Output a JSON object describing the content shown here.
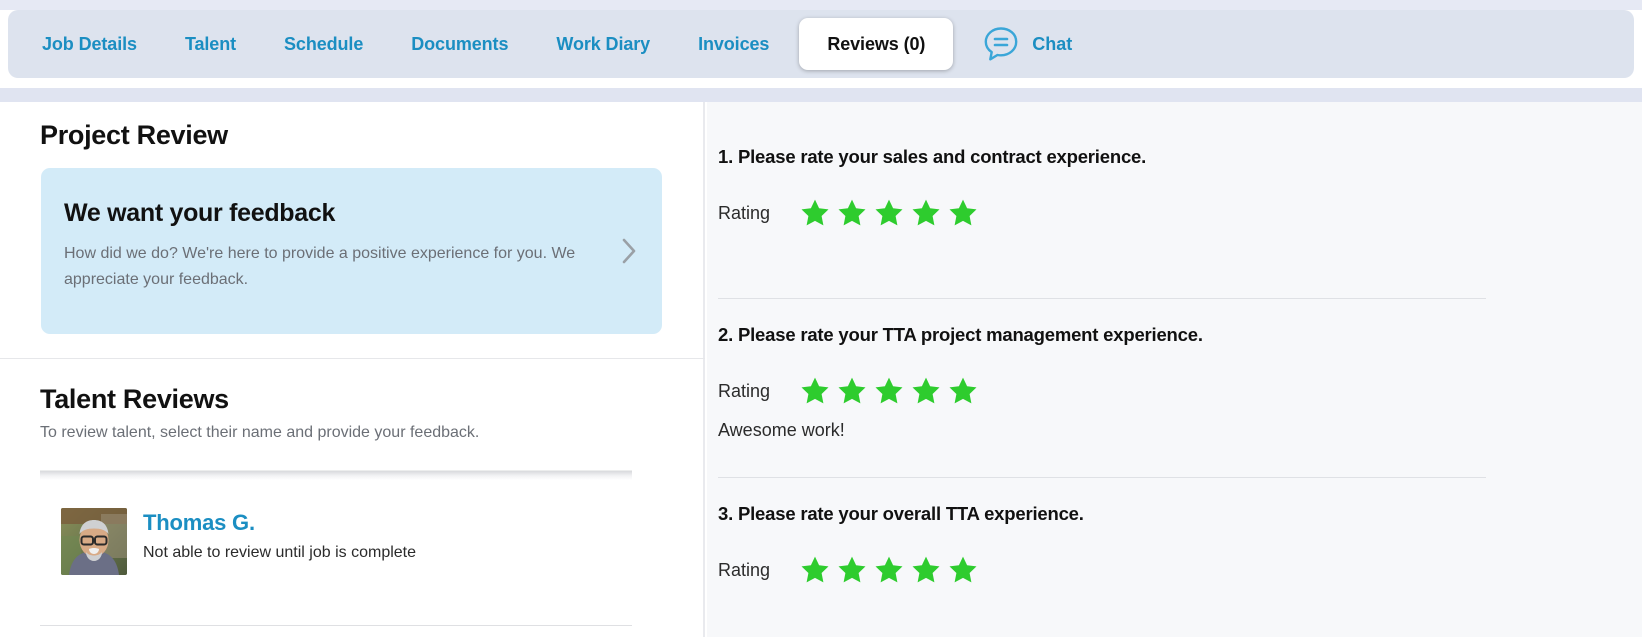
{
  "tabs": [
    {
      "label": "Job Details",
      "active": false
    },
    {
      "label": "Talent",
      "active": false
    },
    {
      "label": "Schedule",
      "active": false
    },
    {
      "label": "Documents",
      "active": false
    },
    {
      "label": "Work Diary",
      "active": false
    },
    {
      "label": "Invoices",
      "active": false
    },
    {
      "label": "Reviews (0)",
      "active": true
    }
  ],
  "chat": {
    "label": "Chat",
    "icon": "chat-bubble-icon"
  },
  "left": {
    "project_review_title": "Project Review",
    "feedback_card": {
      "title": "We want your feedback",
      "subtitle": "How did we do? We're here to provide a positive experience for you. We appreciate your feedback.",
      "chevron": "chevron-right-icon"
    },
    "talent_reviews_title": "Talent Reviews",
    "talent_reviews_subtitle": "To review talent, select their name and provide your feedback.",
    "talent": [
      {
        "name": "Thomas G.",
        "status": "Not able to review until job is complete",
        "avatar": "avatar-photo"
      }
    ]
  },
  "right": {
    "rating_label": "Rating",
    "questions": [
      {
        "number": "1.",
        "text": "1. Please rate your sales and contract experience.",
        "rating": 5,
        "max_rating": 5,
        "comment": ""
      },
      {
        "number": "2.",
        "text": "2. Please rate your TTA project management experience.",
        "rating": 5,
        "max_rating": 5,
        "comment": "Awesome work!"
      },
      {
        "number": "3.",
        "text": "3. Please rate your overall TTA experience.",
        "rating": 5,
        "max_rating": 5,
        "comment": ""
      }
    ]
  },
  "colors": {
    "link_blue": "#1b8ec2",
    "star_green": "#2ecc2e",
    "tabbar_bg": "#dde3ee",
    "feedback_card_bg": "#d3ebf8",
    "right_pane_bg": "#f7f8fa"
  }
}
